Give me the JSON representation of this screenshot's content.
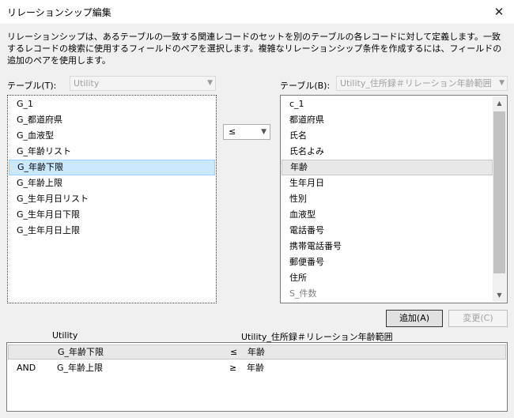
{
  "window": {
    "title": "リレーションシップ編集",
    "close_glyph": "✕"
  },
  "description": "リレーションシップは、あるテーブルの一致する関連レコードのセットを別のテーブルの各レコードに対して定義します。一致するレコードの検索に使用するフィールドのペアを選択します。複雑なリレーションシップ条件を作成するには、フィールドの追加のペアを使用します。",
  "left_table": {
    "label": "テーブル(T):",
    "value": "Utility",
    "fields": [
      "G_1",
      "G_都道府県",
      "G_血液型",
      "G_年齢リスト",
      "G_年齢下限",
      "G_年齢上限",
      "G_生年月日リスト",
      "G_生年月日下限",
      "G_生年月日上限"
    ],
    "selected_field": "G_年齢下限"
  },
  "right_table": {
    "label": "テーブル(B):",
    "value": "Utility_住所録＃リレーション年齢範囲",
    "fields": [
      "c_1",
      "都道府県",
      "氏名",
      "氏名よみ",
      "年齢",
      "生年月日",
      "性別",
      "血液型",
      "電話番号",
      "携帯電話番号",
      "郵便番号",
      "住所",
      "S_件数"
    ],
    "selected_field": "年齢"
  },
  "operator": {
    "value": "≤"
  },
  "buttons": {
    "add": "追加(A)",
    "change": "変更(C)"
  },
  "relations": {
    "header_left": "Utility",
    "header_right": "Utility_住所録＃リレーション年齢範囲",
    "rows": [
      {
        "conj": "",
        "left": "G_年齢下限",
        "op": "≤",
        "right": "年齢"
      },
      {
        "conj": "AND",
        "left": "G_年齢上限",
        "op": "≥",
        "right": "年齢"
      }
    ]
  }
}
